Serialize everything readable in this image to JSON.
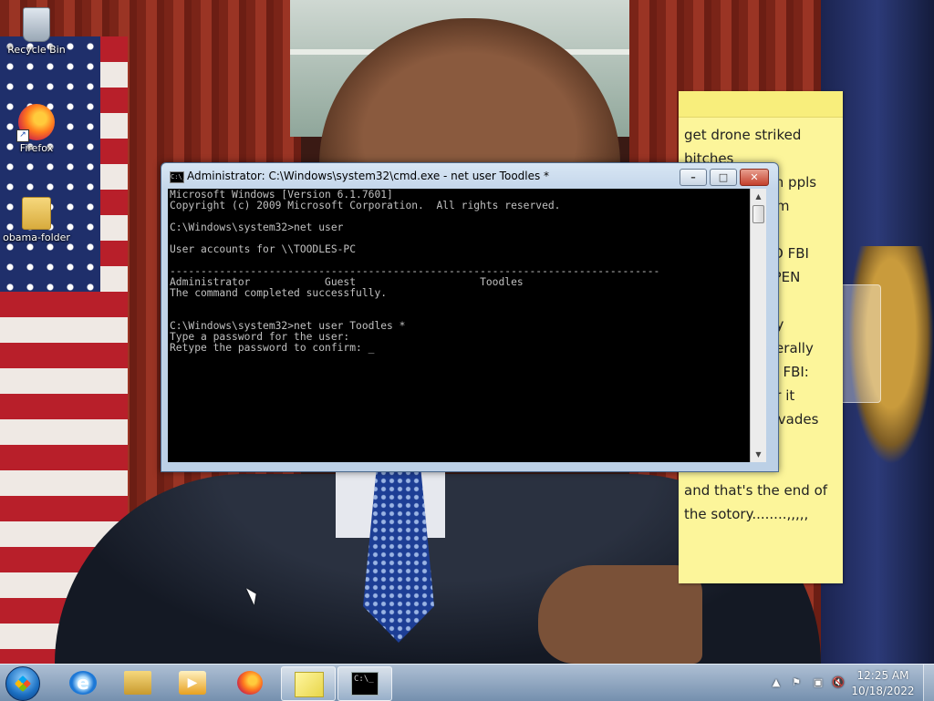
{
  "desktop": {
    "icons": [
      {
        "label": "Recycle Bin",
        "icon": "recycle-bin-icon"
      },
      {
        "label": "Firefox",
        "icon": "firefox-icon"
      },
      {
        "label": "obama-folder",
        "icon": "folder-icon"
      }
    ]
  },
  "sticky_note": {
    "text": "get drone striked\nbitches\n                   on ppls\n                  rom\n\n                  NO FBI\n                  OPEN\n\n                  my\n                  literally\n                  ok FBI:\n                  for it\n(              ) (invades\nhouse)\n\nand that's the end of\nthe sotory........,,,,,"
  },
  "cmd_window": {
    "title": "Administrator: C:\\Windows\\system32\\cmd.exe - net  user Toodles *",
    "icon_label": "C:\\_",
    "output": "Microsoft Windows [Version 6.1.7601]\nCopyright (c) 2009 Microsoft Corporation.  All rights reserved.\n\nC:\\Windows\\system32>net user\n\nUser accounts for \\\\TOODLES-PC\n\n-------------------------------------------------------------------------------\nAdministrator            Guest                    Toodles\nThe command completed successfully.\n\n\nC:\\Windows\\system32>net user Toodles *\nType a password for the user:\nRetype the password to confirm: _",
    "buttons": {
      "minimize": "–",
      "maximize": "□",
      "close": "✕"
    }
  },
  "taskbar": {
    "pinned": [
      {
        "name": "internet-explorer",
        "glyph": "e"
      },
      {
        "name": "windows-explorer",
        "glyph": ""
      },
      {
        "name": "windows-media-player",
        "glyph": "▶"
      },
      {
        "name": "firefox",
        "glyph": ""
      },
      {
        "name": "sticky-notes",
        "glyph": ""
      },
      {
        "name": "command-prompt",
        "glyph": "C:\\_"
      }
    ],
    "tray": {
      "show_hidden": "▲",
      "flag": "⚑",
      "network": "▣",
      "volume": "🔇"
    },
    "clock": {
      "time": "12:25 AM",
      "date": "10/18/2022"
    }
  }
}
